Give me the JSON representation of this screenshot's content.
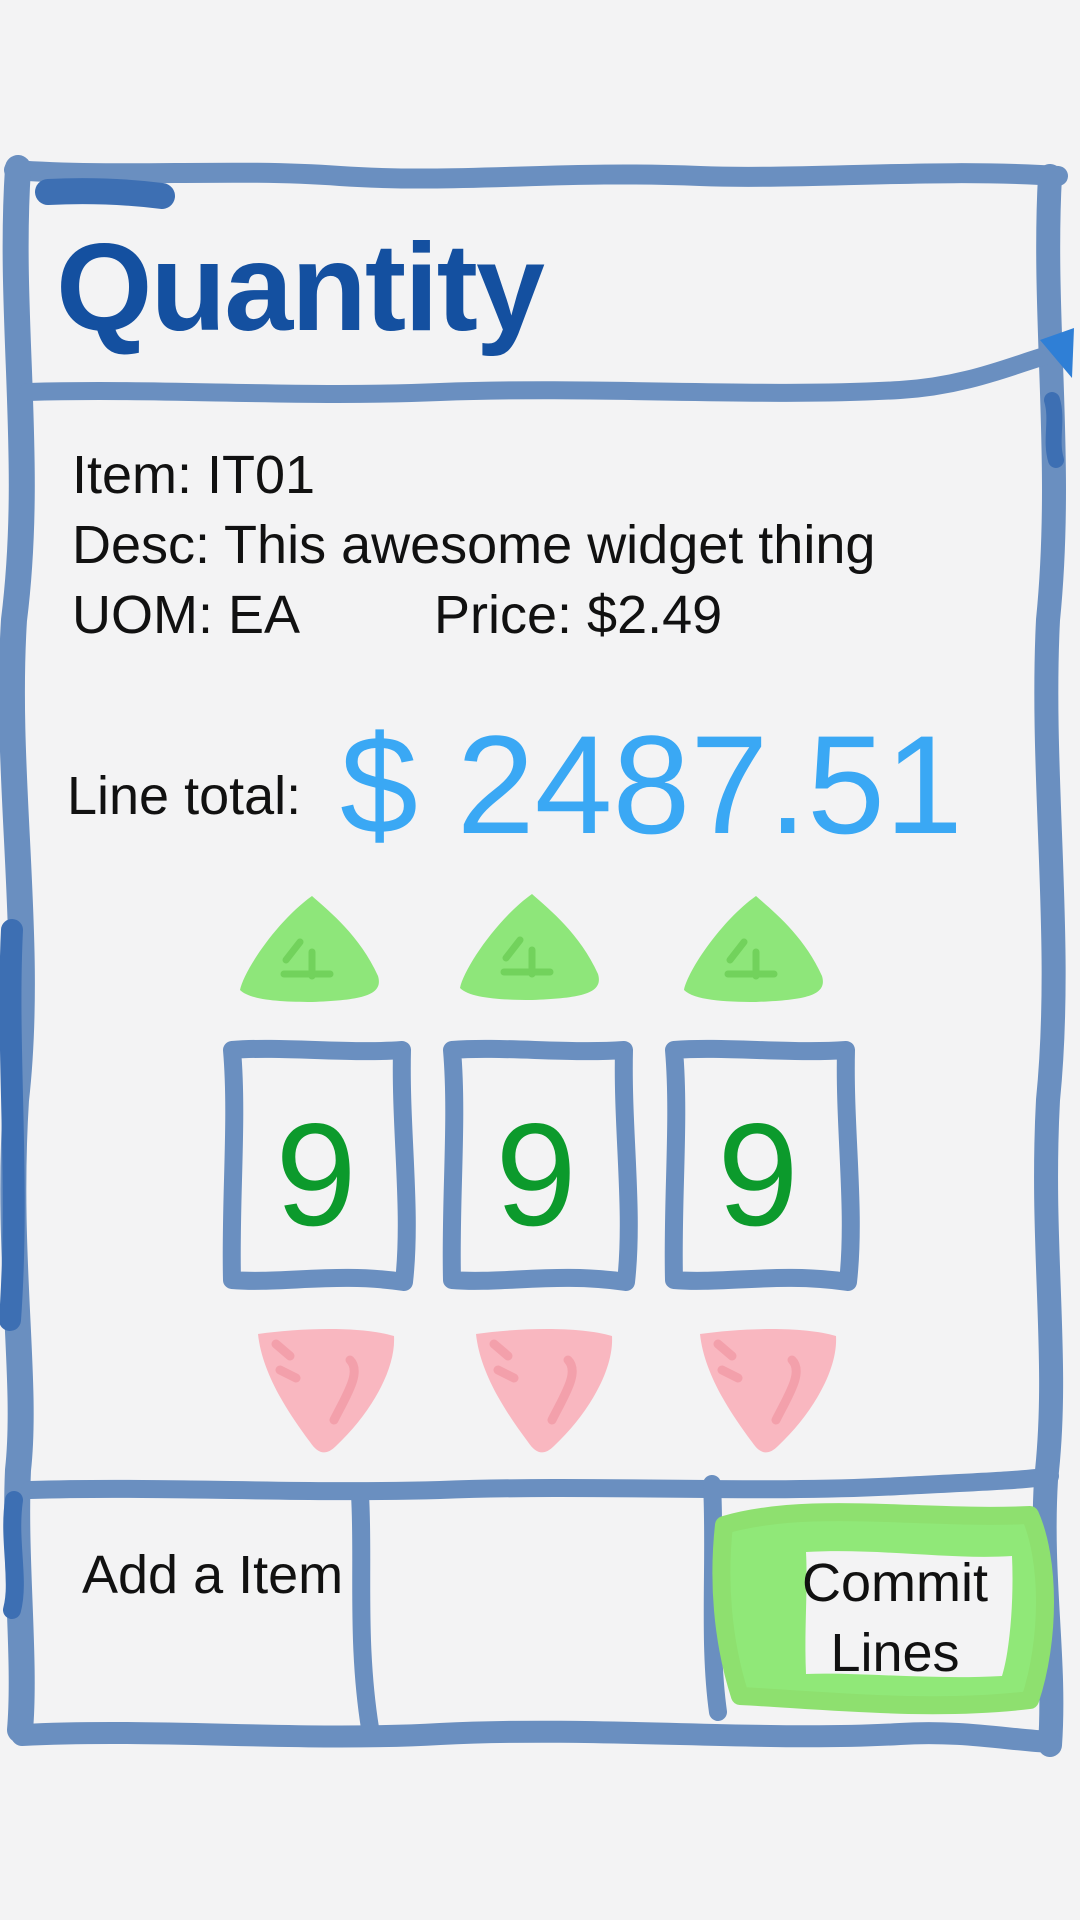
{
  "colors": {
    "sketch_blue": "#6a8fc0",
    "title_blue": "#1450a0",
    "total_blue": "#3aa8f4",
    "digit_green": "#0c9a2c",
    "up_arrow_green": "#8ee67a",
    "down_arrow_pink": "#f9b7c0",
    "commit_highlight": "#90e878",
    "background": "#f3f3f4"
  },
  "header": {
    "title": "Quantity"
  },
  "item": {
    "item_line": "Item: IT01",
    "desc_line": "Desc: This awesome widget thing",
    "uom_line": "UOM: EA",
    "price_line": "Price: $2.49"
  },
  "line_total": {
    "label": "Line total:",
    "value": "$ 2487.51"
  },
  "quantity_digits": [
    {
      "value": "9",
      "up_icon": "up-arrow-icon",
      "down_icon": "down-arrow-icon"
    },
    {
      "value": "9",
      "up_icon": "up-arrow-icon",
      "down_icon": "down-arrow-icon"
    },
    {
      "value": "9",
      "up_icon": "up-arrow-icon",
      "down_icon": "down-arrow-icon"
    }
  ],
  "footer": {
    "add_item_label": "Add a Item",
    "commit_label_line1": "Commit",
    "commit_label_line2": "Lines"
  }
}
